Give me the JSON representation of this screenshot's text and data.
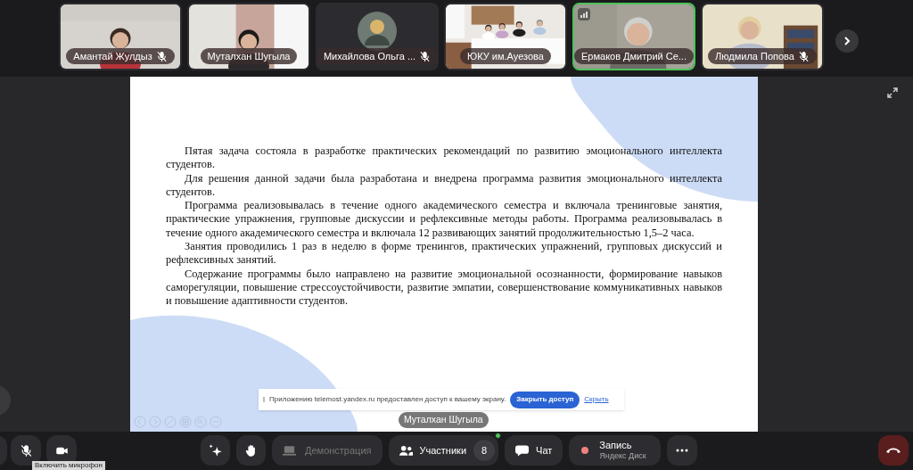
{
  "participants": [
    {
      "name": "Амантай Жулдыз",
      "muted": true,
      "speaking": false,
      "kind": "video"
    },
    {
      "name": "Муталхан Шугыла",
      "muted": false,
      "speaking": false,
      "kind": "video"
    },
    {
      "name": "Михайлова Ольга ...",
      "muted": true,
      "speaking": false,
      "kind": "avatar"
    },
    {
      "name": "ЮКУ им.Ауезова",
      "muted": false,
      "speaking": false,
      "kind": "video"
    },
    {
      "name": "Ермаков Дмитрий Се...",
      "muted": false,
      "speaking": true,
      "kind": "video"
    },
    {
      "name": "Людмила Попова",
      "muted": true,
      "speaking": false,
      "kind": "video"
    }
  ],
  "slide": {
    "paragraphs": [
      "Пятая задача состояла в разработке практических рекомендаций по развитию эмоционального интеллекта студентов.",
      "Для решения данной задачи была разработана и внедрена программа развития эмоционального интеллекта студентов.",
      "Программа реализовывалась в течение одного академического семестра и включала тренинговые занятия, практические упражнения, групповые дискуссии и рефлексивные методы работы. Программа реализовывалась в течение одного академического семестра и включала 12 развивающих занятий продолжительностью 1,5–2 часа.",
      "Занятия проводились 1 раз в неделю в форме тренингов, практических упражнений, групповых дискуссий и рефлексивных занятий.",
      "Содержание программы было направлено на развитие эмоциональной осознанности, формирование навыков саморегуляции, повышение стрессоустойчивости, развитие эмпатии, совершенствование коммуникативных навыков и повышение адаптивности студентов."
    ]
  },
  "share_banner": {
    "text": "Приложению telemost.yandex.ru предоставлен доступ к вашему экрану.",
    "button": "Закрыть доступ",
    "link": "Скрыть"
  },
  "presenter": "Муталхан Шугыла",
  "tooltip": "Включить микрофон",
  "toolbar": {
    "mic_on": false,
    "demo": {
      "label": "Демонстрация",
      "disabled": true
    },
    "participants": {
      "label": "Участники",
      "count": "8"
    },
    "chat": "Чат",
    "record": {
      "label": "Запись",
      "sub": "Яндекс Диск"
    }
  }
}
